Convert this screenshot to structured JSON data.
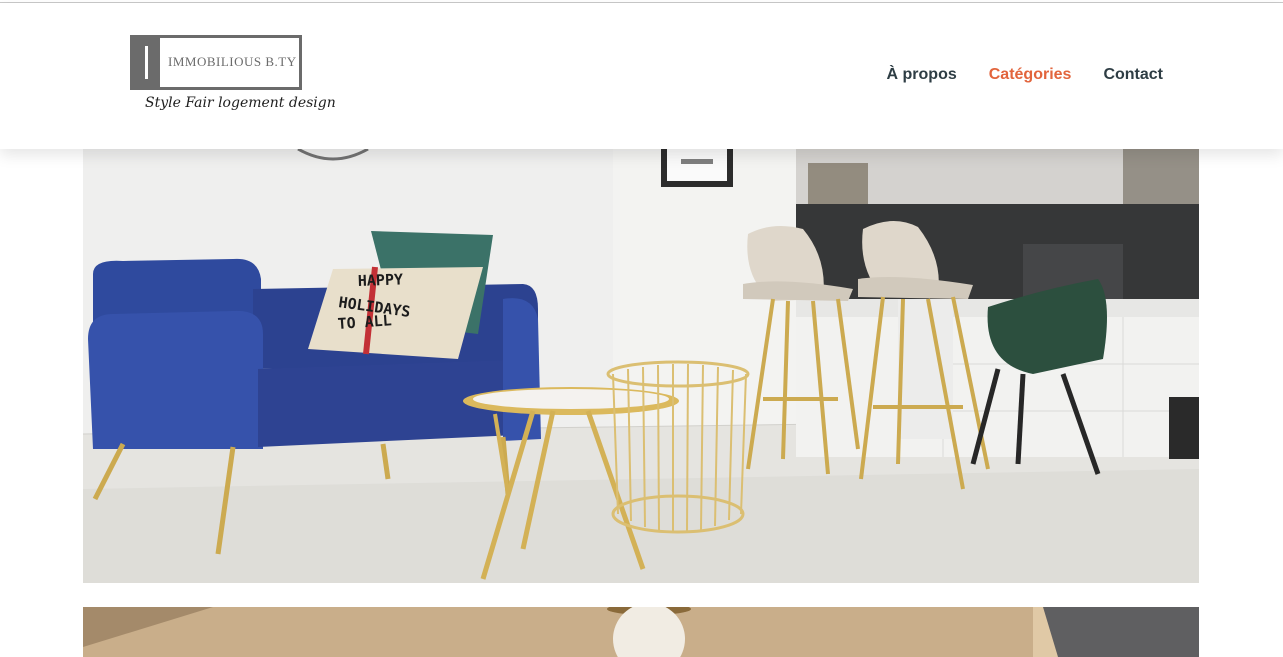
{
  "brand": {
    "name": "IMMOBILIOUS B.TY",
    "tagline": "Style Fair logement design",
    "color": "#6b6b6b"
  },
  "nav": {
    "items": [
      {
        "label": "À propos",
        "active": false
      },
      {
        "label": "Catégories",
        "active": true
      },
      {
        "label": "Contact",
        "active": false
      }
    ],
    "accent_color": "#e2643c",
    "text_color": "#2e3d44"
  },
  "hero": {
    "pillow_text": [
      "HAPPY",
      "HOLIDAYS",
      "TO ALL"
    ]
  }
}
